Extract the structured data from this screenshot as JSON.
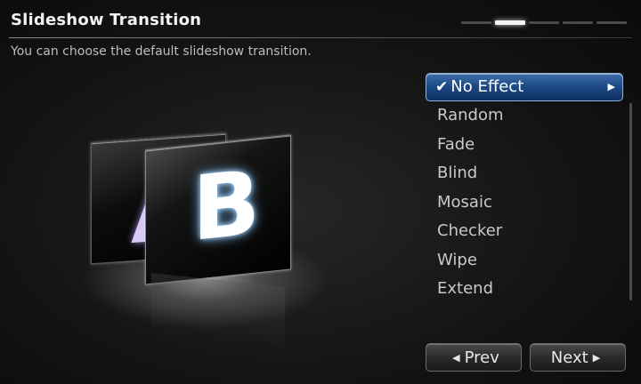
{
  "header": {
    "title": "Slideshow Transition",
    "subtitle": "You can choose the default slideshow transition.",
    "steps_total": 5,
    "step_active": 2
  },
  "preview": {
    "back_letter": "A",
    "front_letter": "B"
  },
  "options": {
    "selected": "No Effect",
    "items": [
      "No Effect",
      "Random",
      "Fade",
      "Blind",
      "Mosaic",
      "Checker",
      "Wipe",
      "Extend"
    ]
  },
  "icons": {
    "check": "check-icon",
    "submenu": "arrow-right-icon",
    "prev": "arrow-left-icon",
    "next": "arrow-right-icon"
  },
  "nav": {
    "prev_label": "Prev",
    "next_label": "Next"
  },
  "colors": {
    "selection_highlight": "#1d4b86",
    "background": "#141414"
  }
}
